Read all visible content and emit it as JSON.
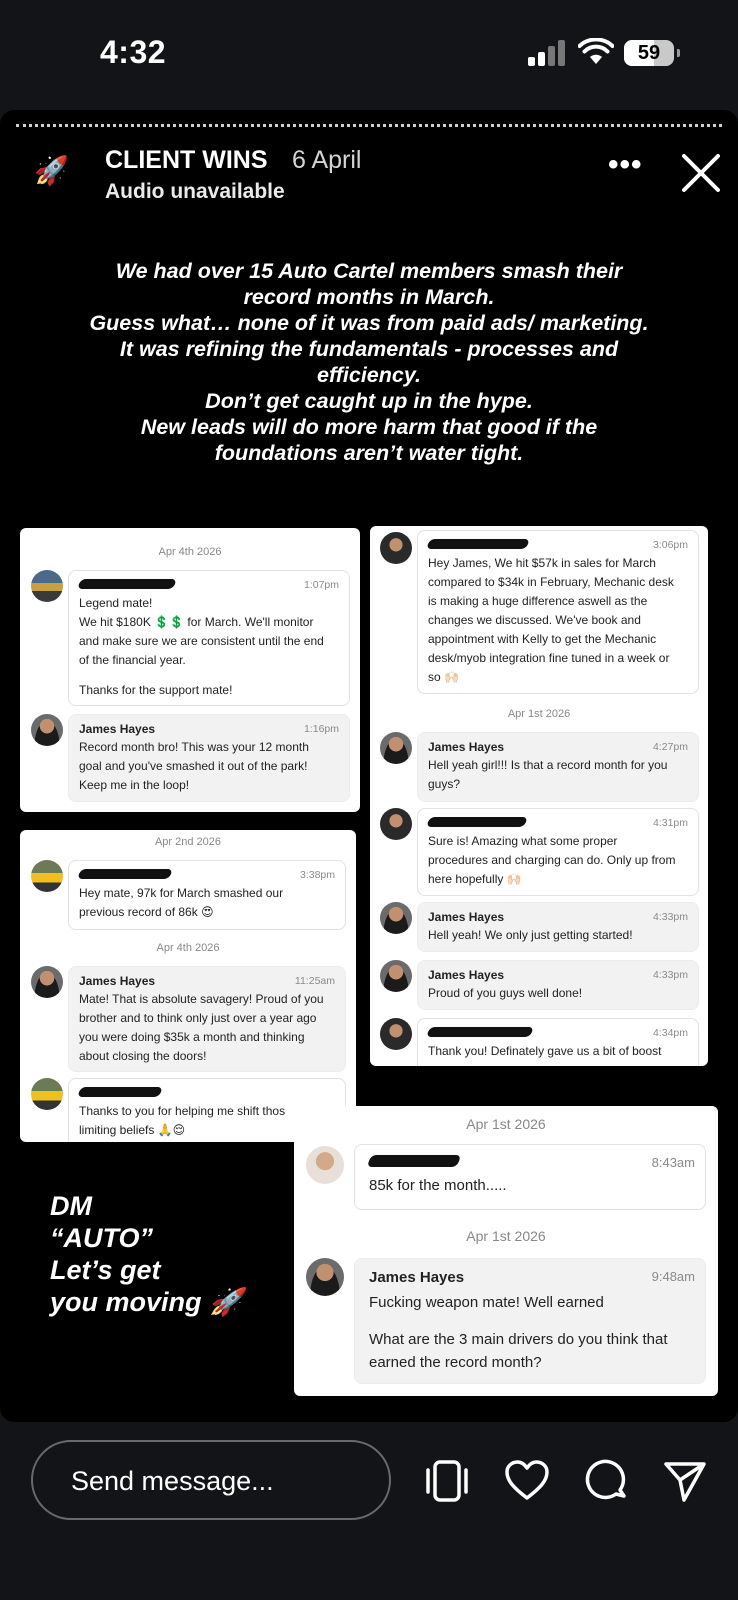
{
  "status_bar": {
    "time": "4:32",
    "battery": "59",
    "battery_level": 0.59
  },
  "story": {
    "title": "CLIENT WINS",
    "date": "6 April",
    "audio": "Audio unavailable",
    "headline": [
      "We had over 15 Auto Cartel members smash their",
      "record months in March.",
      "Guess what… none of it was from paid ads/ marketing.",
      "It was refining the fundamentals - processes and",
      "efficiency.",
      "Don’t get caught up in the hype.",
      "New leads will do more harm that good if the",
      "foundations aren’t water tight."
    ],
    "cta": "DM\n“AUTO”\nLet’s get\nyou moving 🚀"
  },
  "card1": {
    "day": "Apr 4th 2026",
    "m1": {
      "time": "1:07pm",
      "text": "Legend mate!\nWe hit $180K 💲💲 for March. We'll monitor\nand make sure we are consistent until the end\nof the financial year.",
      "text2": "Thanks for the support mate!"
    },
    "m2": {
      "sender": "James Hayes",
      "time": "1:16pm",
      "text": "Record month bro! This was your 12 month\ngoal and you've smashed it out of the park!\nKeep me in the loop!"
    }
  },
  "card2": {
    "day1": "Apr 2nd 2026",
    "m1": {
      "time": "3:38pm",
      "text": "Hey mate, 97k for March smashed our\nprevious record of 86k 😍"
    },
    "day2": "Apr 4th 2026",
    "m2": {
      "sender": "James Hayes",
      "time": "11:25am",
      "text": "Mate! That is absolute savagery! Proud of you\nbrother and to think only just over a year ago\nyou were doing $35k a month and thinking\nabout closing the doors!"
    },
    "m3": {
      "text": "Thanks to you for helping me shift thos\nlimiting beliefs 🙏😌"
    }
  },
  "card3": {
    "m1": {
      "time": "3:06pm",
      "text": "Hey James, We hit $57k in sales for March\ncompared to $34k in February, Mechanic desk\nis making a huge difference aswell as the\nchanges we discussed. We've book and\nappointment with Kelly to get the Mechanic\ndesk/myob integration fine tuned in a week or\nso 🙌🏻"
    },
    "day": "Apr 1st 2026",
    "m2": {
      "sender": "James Hayes",
      "time": "4:27pm",
      "text": "Hell yeah girl!!! Is that a record month for you\nguys?"
    },
    "m3": {
      "time": "4:31pm",
      "text": "Sure is! Amazing what some proper\nprocedures and charging can do. Only up from\nhere hopefully 🙌🏻"
    },
    "m4": {
      "sender": "James Hayes",
      "time": "4:33pm",
      "text": "Hell yeah! We only just getting started!"
    },
    "m5": {
      "sender": "James Hayes",
      "time": "4:33pm",
      "text": "Proud of you guys well done!"
    },
    "m6": {
      "time": "4:34pm",
      "text": "Thank you! Definately gave us a bit of boost"
    }
  },
  "card4": {
    "day1": "Apr 1st 2026",
    "m1": {
      "time": "8:43am",
      "text": "85k for the month....."
    },
    "day2": "Apr 1st 2026",
    "m2": {
      "sender": "James Hayes",
      "time": "9:48am",
      "text": "Fucking weapon mate! Well earned",
      "text2": "What are the 3 main drivers do you think that\nearned the record month?"
    }
  },
  "composer": {
    "placeholder": "Send message..."
  },
  "icons": [
    "rocket-icon",
    "more-icon",
    "close-icon",
    "screens-icon",
    "heart-icon",
    "comment-icon",
    "send-icon"
  ]
}
